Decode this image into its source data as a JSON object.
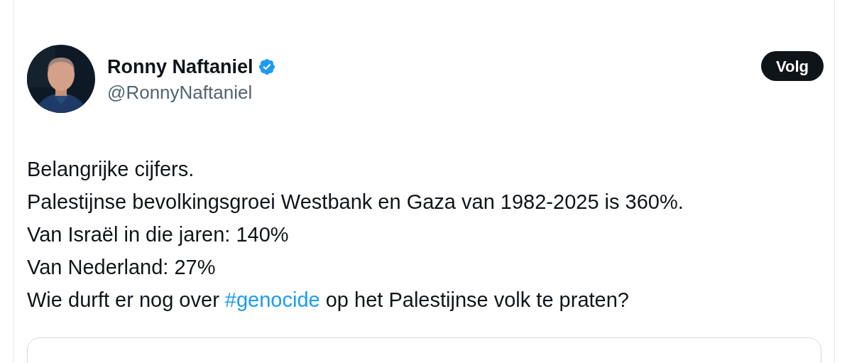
{
  "author": {
    "name": "Ronny Naftaniel",
    "verified": true,
    "handle": "@RonnyNaftaniel"
  },
  "follow_button": {
    "label": "Volg"
  },
  "tweet_lines": [
    {
      "parts": [
        {
          "kind": "text",
          "text": "Belangrijke cijfers."
        }
      ]
    },
    {
      "parts": [
        {
          "kind": "text",
          "text": "Palestijnse bevolkingsgroei Westbank en Gaza van 1982-2025 is 360%."
        }
      ]
    },
    {
      "parts": [
        {
          "kind": "text",
          "text": "Van Israël in die jaren: 140%"
        }
      ]
    },
    {
      "parts": [
        {
          "kind": "text",
          "text": "Van Nederland: 27%"
        }
      ]
    },
    {
      "parts": [
        {
          "kind": "text",
          "text": "Wie durft er nog over "
        },
        {
          "kind": "hashtag",
          "text": "#genocide"
        },
        {
          "kind": "text",
          "text": " op het Palestijnse volk te praten?"
        }
      ]
    }
  ],
  "quoted_card": {
    "kind": "card"
  }
}
